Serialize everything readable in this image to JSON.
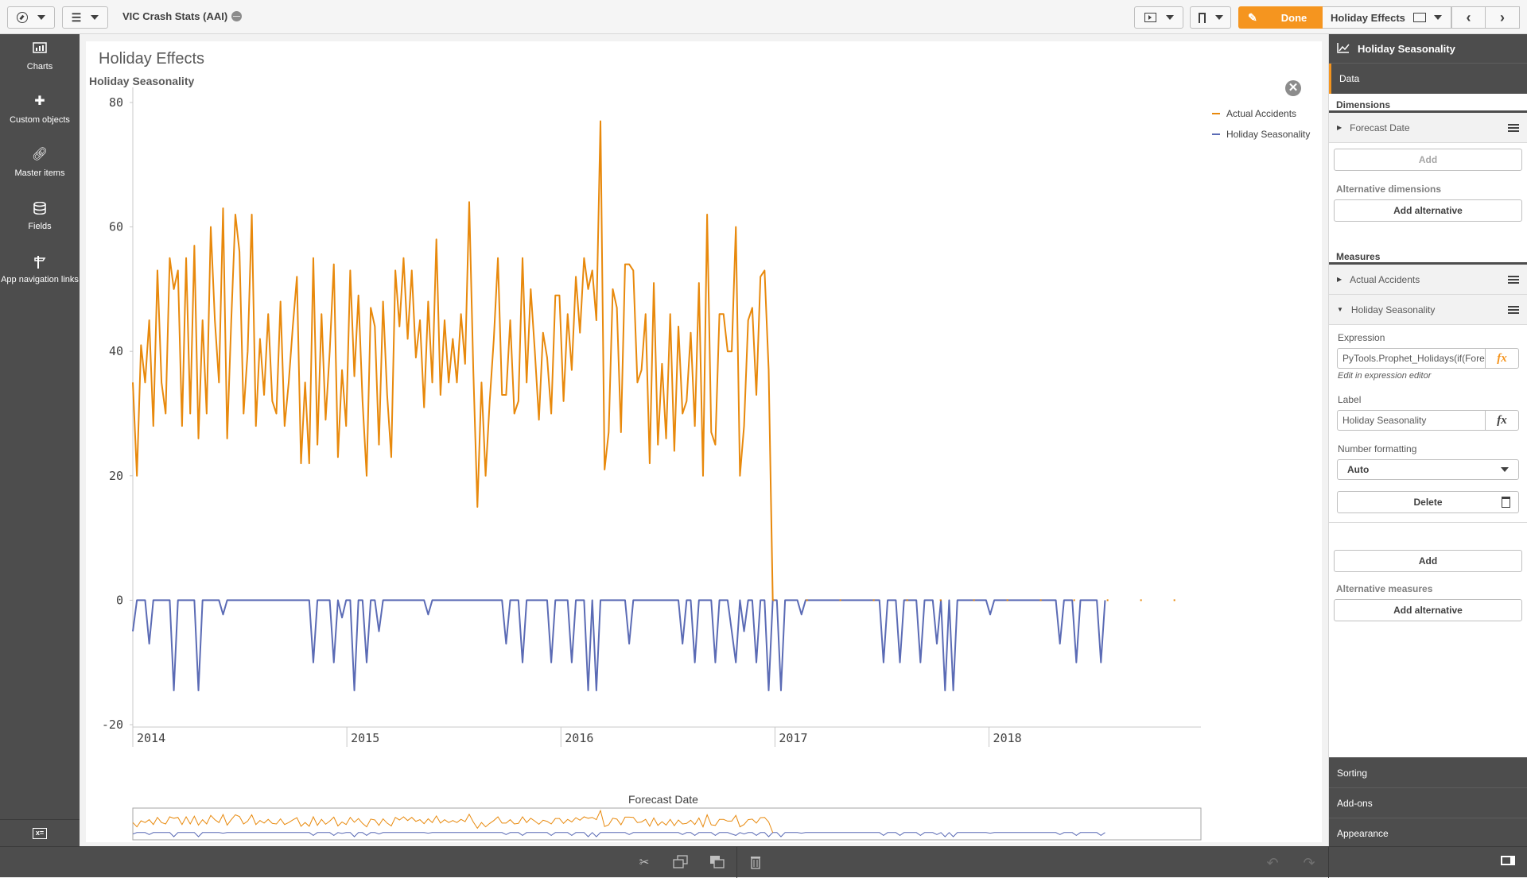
{
  "topbar": {
    "app_title": "VIC Crash Stats (AAI)",
    "nav_menu_icon": "compass-icon",
    "list_menu_icon": "list-icon",
    "present_icon": "presentation-icon",
    "bookmark_icon": "bookmark-icon",
    "done_label": "Done",
    "sheet_label": "Holiday Effects",
    "prev_label": "‹",
    "next_label": "›"
  },
  "leftbar": {
    "items": [
      {
        "label": "Charts",
        "icon": "bar-chart-icon"
      },
      {
        "label": "Custom objects",
        "icon": "puzzle-icon"
      },
      {
        "label": "Master items",
        "icon": "link-icon"
      },
      {
        "label": "Fields",
        "icon": "database-icon"
      },
      {
        "label": "App navigation links",
        "icon": "signpost-icon"
      }
    ],
    "bottom_icon": "variables-icon"
  },
  "sheet": {
    "title": "Holiday Effects"
  },
  "chart_data": {
    "type": "line",
    "title": "Holiday Seasonality",
    "xlabel": "Forecast Date",
    "ylabel": "",
    "ylim": [
      -20,
      80
    ],
    "yticks": [
      "80",
      "60",
      "40",
      "20",
      "0",
      "-20"
    ],
    "ytick_values": [
      80,
      60,
      40,
      20,
      0,
      -20
    ],
    "xticks": [
      "2014",
      "2015",
      "2016",
      "2017",
      "2018"
    ],
    "x_range_years": [
      2014.0,
      2018.99
    ],
    "grid": false,
    "legend": "top-right",
    "series": [
      {
        "name": "Actual Accidents",
        "color": "#e8890c",
        "start_year": 2014.0,
        "step_weeks": 1,
        "values": [
          35,
          20,
          41,
          35,
          45,
          28,
          53,
          35,
          30,
          55,
          50,
          53,
          28,
          55,
          30,
          57,
          26,
          45,
          30,
          60,
          45,
          35,
          63,
          26,
          45,
          62,
          56,
          30,
          40,
          62,
          28,
          42,
          33,
          46,
          32,
          30,
          48,
          28,
          35,
          44,
          52,
          22,
          35,
          22,
          55,
          25,
          46,
          29,
          40,
          54,
          23,
          37,
          28,
          53,
          36,
          49,
          32,
          20,
          47,
          44,
          25,
          48,
          33,
          23,
          53,
          44,
          55,
          42,
          53,
          39,
          45,
          31,
          48,
          35,
          58,
          33,
          45,
          35,
          42,
          35,
          46,
          38,
          64,
          37,
          15,
          35,
          20,
          32,
          42,
          55,
          33,
          33,
          45,
          30,
          32,
          55,
          35,
          50,
          40,
          29,
          43,
          39,
          30,
          49,
          49,
          32,
          46,
          37,
          52,
          43,
          55,
          50,
          53,
          45,
          77,
          21,
          27,
          50,
          47,
          27,
          54,
          54,
          53,
          35,
          37,
          46,
          22,
          51,
          25,
          38,
          26,
          46,
          24,
          44,
          30,
          32,
          43,
          28,
          51,
          20,
          62,
          27,
          25,
          46,
          46,
          40,
          40,
          60,
          20,
          28,
          45,
          47,
          33,
          52,
          53,
          37,
          0
        ]
      },
      {
        "name": "Holiday Seasonality",
        "color": "#5b6bb5",
        "start_year": 2014.0,
        "step_weeks": 1,
        "values": [
          -5,
          0,
          0,
          0,
          -7,
          0,
          0,
          0,
          0,
          0,
          -14.5,
          0,
          0,
          0,
          0,
          0,
          -14.5,
          0,
          0,
          0,
          0,
          0,
          -2.3,
          0,
          0,
          0,
          0,
          0,
          0,
          0,
          0,
          0,
          0,
          0,
          0,
          0,
          0,
          0,
          0,
          0,
          0,
          0,
          0,
          0,
          -10,
          0,
          0,
          0,
          0,
          -10,
          0,
          -2.8,
          0,
          0,
          -14.5,
          0,
          0,
          -10,
          0,
          0,
          -5,
          0,
          0,
          0,
          0,
          0,
          0,
          0,
          0,
          0,
          0,
          0,
          -2.3,
          0,
          0,
          0,
          0,
          0,
          0,
          0,
          0,
          0,
          0,
          0,
          0,
          0,
          0,
          0,
          0,
          0,
          0,
          -7,
          0,
          0,
          0,
          -10,
          0,
          0,
          0,
          0,
          0,
          0,
          -10,
          0,
          0,
          0,
          0,
          -10,
          0,
          0,
          0,
          -14.5,
          0,
          -14.5,
          0,
          0,
          0,
          0,
          0,
          0,
          0,
          -7,
          0,
          0,
          0,
          0,
          0,
          0,
          0,
          0,
          0,
          0,
          0,
          0,
          -7,
          0,
          0,
          -10,
          0,
          0,
          0,
          0,
          -10,
          0,
          0,
          0,
          -5,
          -10,
          0,
          -5,
          0,
          0,
          -10,
          0,
          0,
          -14.5,
          0,
          0,
          -14.5,
          0,
          0,
          0,
          0,
          -2.3,
          0,
          0,
          0,
          0,
          0,
          0,
          0,
          0,
          0,
          0,
          0,
          0,
          0,
          0,
          0,
          0,
          0,
          0,
          0,
          -10,
          0,
          0,
          0,
          -10,
          0,
          0,
          0,
          0,
          -10,
          0,
          0,
          0,
          -7,
          0,
          -14.5,
          0,
          -14.5,
          0,
          0,
          0,
          0,
          0,
          0,
          0,
          0,
          -2.3,
          0,
          0,
          0,
          0,
          0,
          0,
          0,
          0,
          0,
          0,
          0,
          0,
          0,
          0,
          0,
          0,
          -7,
          0,
          0,
          0,
          -10,
          0,
          0,
          0,
          0,
          0,
          -10,
          0
        ]
      }
    ]
  },
  "legend": {
    "items": [
      {
        "label": "Actual Accidents",
        "color": "#e8890c"
      },
      {
        "label": "Holiday Seasonality",
        "color": "#5b6bb5"
      }
    ]
  },
  "rightpanel": {
    "header_title": "Holiday Seasonality",
    "header_icon": "line-chart-icon",
    "tab_data": "Data",
    "dimensions_title": "Dimensions",
    "dimension_item": "Forecast Date",
    "add_label": "Add",
    "alt_dimensions_title": "Alternative dimensions",
    "add_alternative_label": "Add alternative",
    "measures_title": "Measures",
    "measure_1": "Actual Accidents",
    "measure_2": "Holiday Seasonality",
    "expression_label": "Expression",
    "expression_value": "PyTools.Prophet_Holidays(if(Forecast",
    "fx_label": "fx",
    "edit_hint": "Edit in expression editor",
    "label_label": "Label",
    "label_value": "Holiday Seasonality",
    "number_formatting_label": "Number formatting",
    "number_formatting_value": "Auto",
    "delete_label": "Delete",
    "add_measure_label": "Add",
    "alt_measures_title": "Alternative measures",
    "add_alt_measure_label": "Add alternative",
    "sorting_label": "Sorting",
    "addons_label": "Add-ons",
    "appearance_label": "Appearance"
  },
  "bottombar": {
    "cut_icon": "scissors-icon",
    "copy_icon": "copy-icon",
    "paste_icon": "paste-icon",
    "delete_icon": "trash-icon",
    "undo_icon": "undo-icon",
    "redo_icon": "redo-icon",
    "toggle_panel_icon": "panel-toggle-icon"
  }
}
